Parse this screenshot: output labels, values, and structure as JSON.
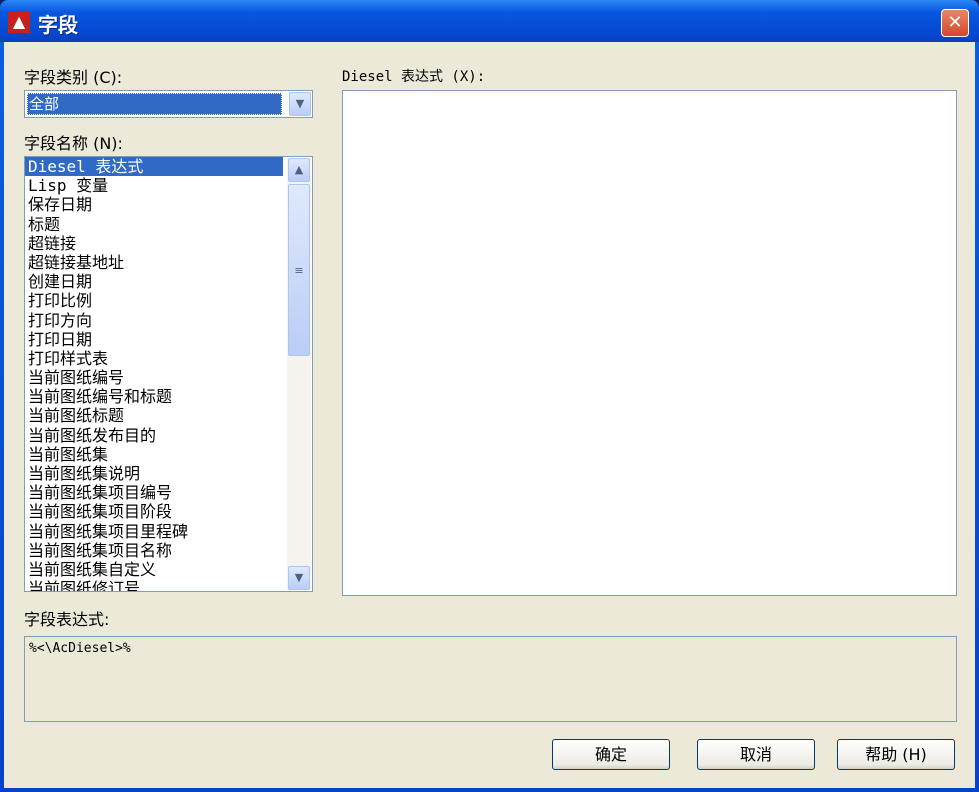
{
  "title": "字段",
  "category_label": "字段类别 (C):",
  "category_value": "全部",
  "names_label": "字段名称 (N):",
  "field_names": [
    "Diesel 表达式",
    "Lisp 变量",
    "保存日期",
    "标题",
    "超链接",
    "超链接基地址",
    "创建日期",
    "打印比例",
    "打印方向",
    "打印日期",
    "打印样式表",
    "当前图纸编号",
    "当前图纸编号和标题",
    "当前图纸标题",
    "当前图纸发布目的",
    "当前图纸集",
    "当前图纸集说明",
    "当前图纸集项目编号",
    "当前图纸集项目阶段",
    "当前图纸集项目里程碑",
    "当前图纸集项目名称",
    "当前图纸集自定义",
    "当前图纸修订号"
  ],
  "diesel_label": "Diesel 表达式 (X):",
  "diesel_value": "",
  "expression_label": "字段表达式:",
  "expression_value": "%<\\AcDiesel>%",
  "buttons": {
    "ok": "确定",
    "cancel": "取消",
    "help": "帮助 (H)"
  }
}
